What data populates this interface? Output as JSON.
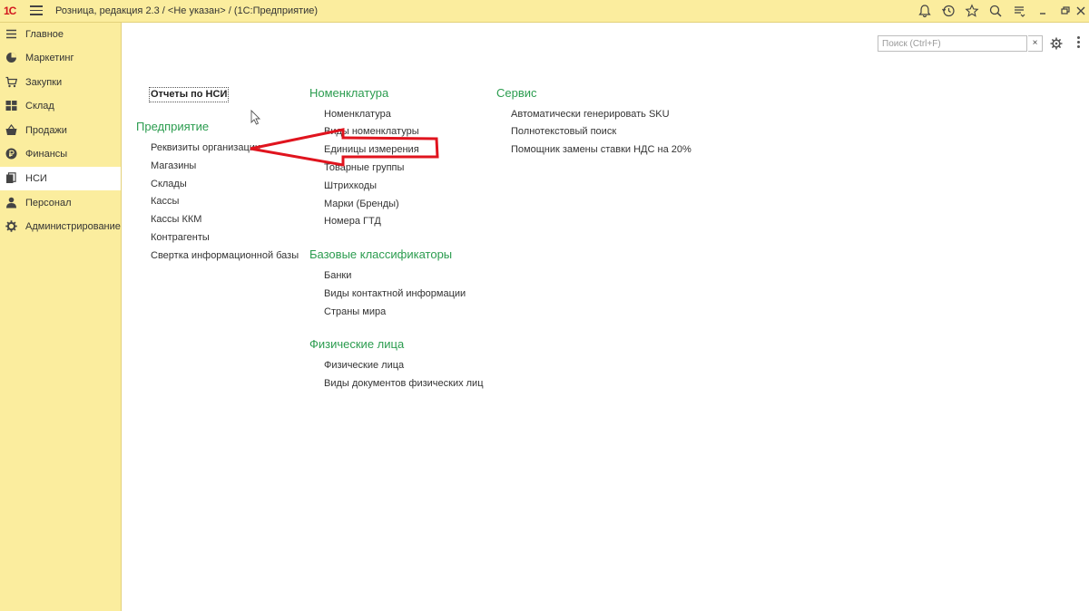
{
  "titlebar": {
    "logo": "1С",
    "app_title": "Розница, редакция 2.3 / <Не указан> /  (1С:Предприятие)"
  },
  "sidebar": {
    "items": [
      {
        "label": "Главное",
        "icon": "list-icon"
      },
      {
        "label": "Маркетинг",
        "icon": "pie-chart-icon"
      },
      {
        "label": "Закупки",
        "icon": "cart-icon"
      },
      {
        "label": "Склад",
        "icon": "warehouse-icon"
      },
      {
        "label": "Продажи",
        "icon": "basket-icon"
      },
      {
        "label": "Финансы",
        "icon": "ruble-icon"
      },
      {
        "label": "НСИ",
        "icon": "book-icon"
      },
      {
        "label": "Персонал",
        "icon": "person-icon"
      },
      {
        "label": "Администрирование",
        "icon": "gear-icon"
      }
    ],
    "active": "НСИ"
  },
  "search": {
    "placeholder": "Поиск (Ctrl+F)",
    "value": "",
    "clear_label": "×"
  },
  "content": {
    "report_button": "Отчеты по НСИ",
    "enterprise": {
      "title": "Предприятие",
      "links": [
        "Реквизиты организации",
        "Магазины",
        "Склады",
        "Кассы",
        "Кассы ККМ",
        "Контрагенты",
        "Свертка информационной базы"
      ]
    },
    "nomenclature": {
      "title": "Номенклатура",
      "links": [
        "Номенклатура",
        "Виды номенклатуры",
        "Единицы измерения",
        "Товарные группы",
        "Штрихкоды",
        "Марки (Бренды)",
        "Номера ГТД"
      ]
    },
    "classifiers": {
      "title": "Базовые классификаторы",
      "links": [
        "Банки",
        "Виды контактной информации",
        "Страны мира"
      ]
    },
    "persons": {
      "title": "Физические лица",
      "links": [
        "Физические лица",
        "Виды документов физических лиц"
      ]
    },
    "service": {
      "title": "Сервис",
      "links": [
        "Автоматически генерировать SKU",
        "Полнотекстовый поиск",
        "Помощник замены ставки НДС на 20%"
      ]
    }
  },
  "colors": {
    "sidebar_bg": "#fbed9e",
    "section_title": "#2b9c4f",
    "annotation": "#e0141e"
  }
}
